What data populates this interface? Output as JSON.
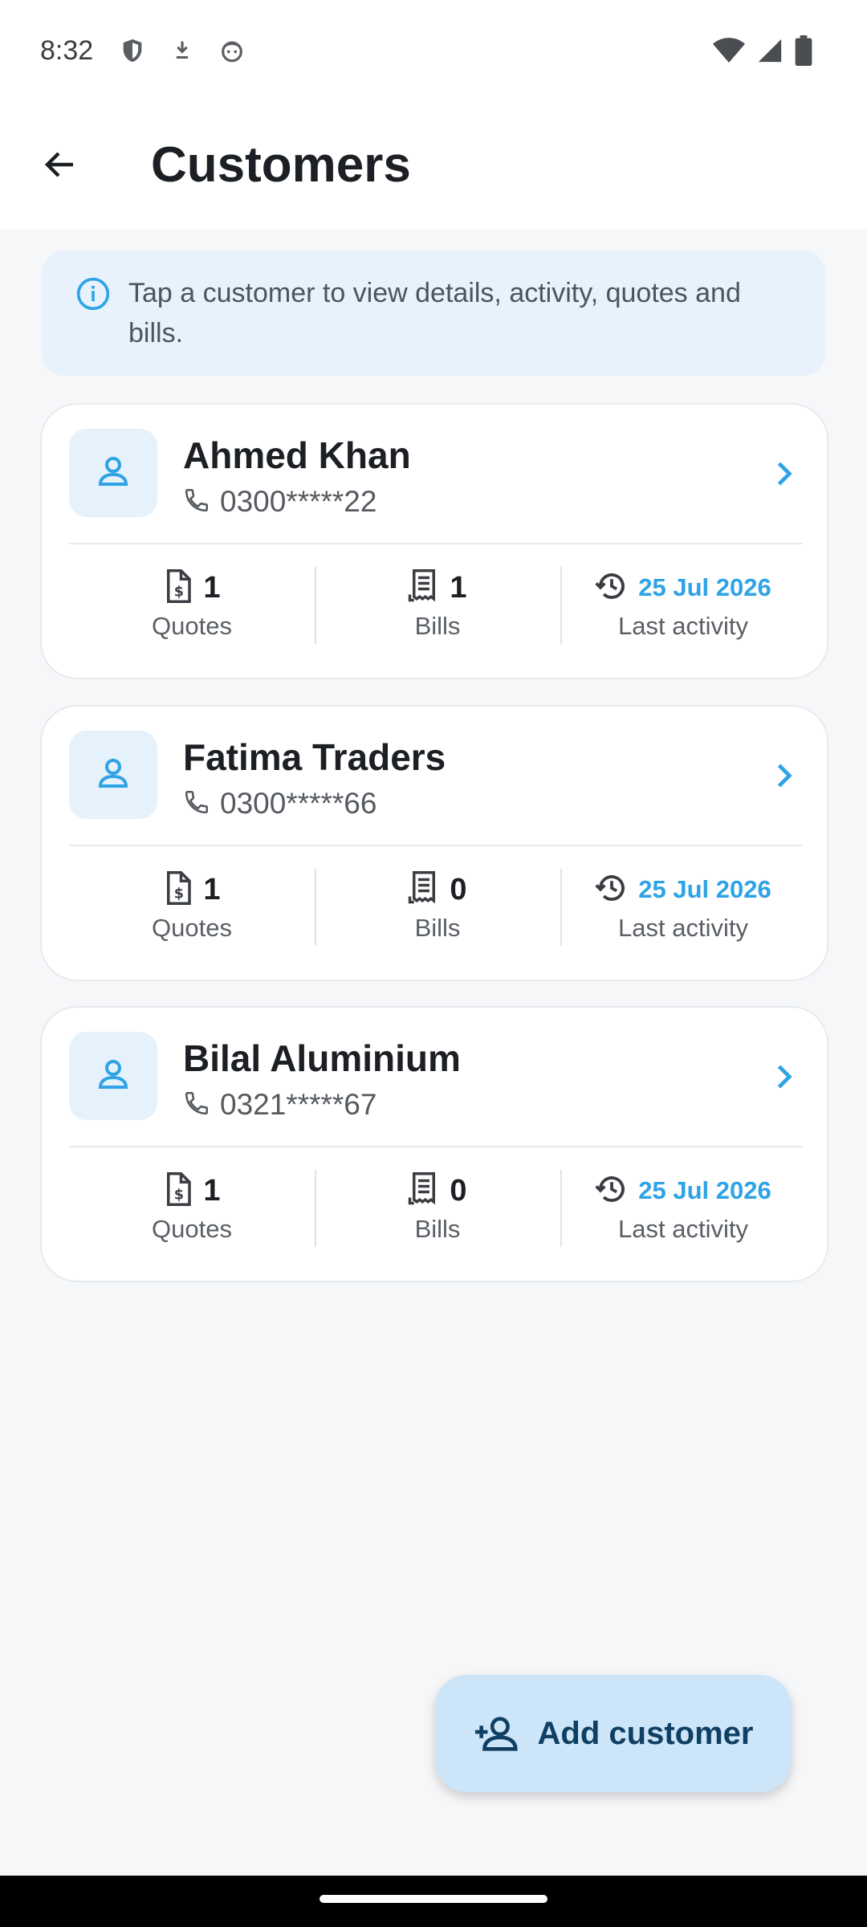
{
  "status_bar": {
    "time": "8:32"
  },
  "app_bar": {
    "title": "Customers"
  },
  "info_banner": {
    "text": "Tap a customer to view details, activity, quotes and bills."
  },
  "labels": {
    "quotes": "Quotes",
    "bills": "Bills",
    "last_activity": "Last activity"
  },
  "customers": [
    {
      "name": "Ahmed Khan",
      "phone": "0300*****22",
      "quotes": "1",
      "bills": "1",
      "last_activity": "25 Jul 2026"
    },
    {
      "name": "Fatima Traders",
      "phone": "0300*****66",
      "quotes": "1",
      "bills": "0",
      "last_activity": "25 Jul 2026"
    },
    {
      "name": "Bilal Aluminium",
      "phone": "0321*****67",
      "quotes": "1",
      "bills": "0",
      "last_activity": "25 Jul 2026"
    }
  ],
  "fab": {
    "label": "Add customer"
  },
  "colors": {
    "accent": "#2ea3e6",
    "fab_bg": "#cde5f8",
    "banner_bg": "#e8f2fc"
  },
  "icons": [
    "back-arrow-icon",
    "info-icon",
    "person-icon",
    "phone-icon",
    "chevron-right-icon",
    "quote-doc-icon",
    "receipt-icon",
    "history-icon",
    "person-add-icon"
  ]
}
